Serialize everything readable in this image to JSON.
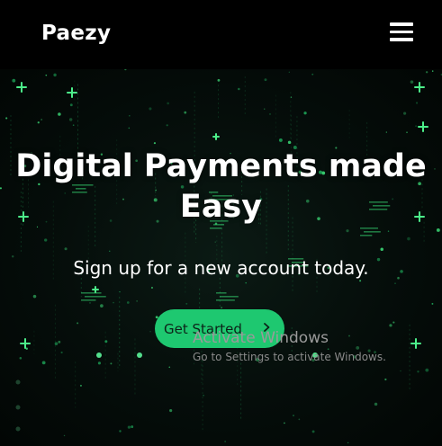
{
  "navbar": {
    "brand": "Paezy",
    "menu_icon": "hamburger-menu-icon"
  },
  "hero": {
    "title": "Digital Payments made Easy",
    "subtitle": "Sign up for a new account today.",
    "cta_label": "Get Started",
    "cta_icon": "chevron-right-icon",
    "background_icon": "digital-particles-background"
  },
  "watermark": {
    "title": "Activate Windows",
    "subtitle": "Go to Settings to activate Windows."
  },
  "colors": {
    "navbar_bg": "#000000",
    "hero_bg": "#050d0a",
    "accent": "#1ec870",
    "text": "#ffffff"
  }
}
